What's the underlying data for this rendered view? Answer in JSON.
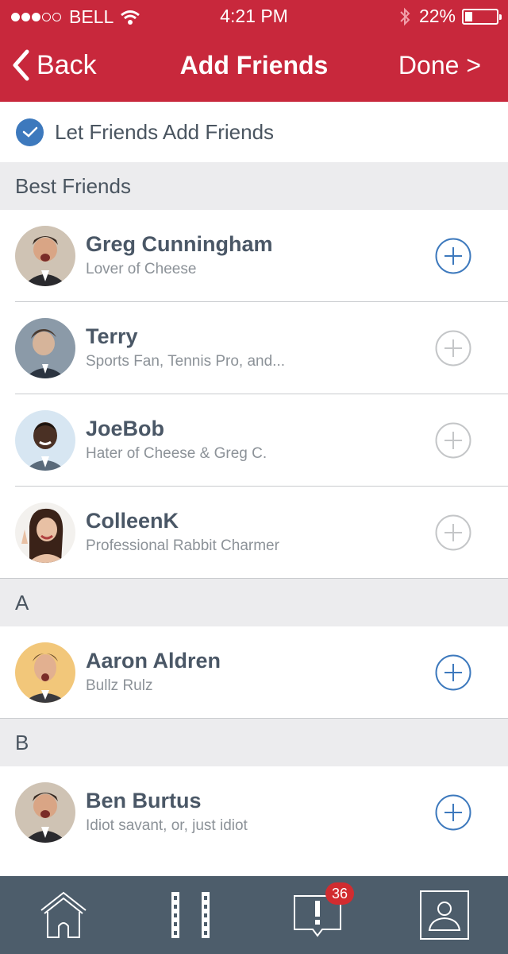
{
  "status_bar": {
    "carrier": "BELL",
    "time": "4:21 PM",
    "battery": "22%",
    "battery_level": 0.22,
    "signal_bars_filled": 3,
    "signal_bars_total": 5
  },
  "nav": {
    "back_label": "Back",
    "title": "Add Friends",
    "done_label": "Done >"
  },
  "toggle": {
    "label": "Let Friends Add Friends",
    "checked": true
  },
  "sections": [
    {
      "title": "Best Friends",
      "friends": [
        {
          "name": "Greg Cunningham",
          "subtitle": "Lover of Cheese",
          "add_active": true
        },
        {
          "name": "Terry",
          "subtitle": "Sports Fan, Tennis Pro, and...",
          "add_active": false
        },
        {
          "name": "JoeBob",
          "subtitle": "Hater of Cheese & Greg C.",
          "add_active": false
        },
        {
          "name": "ColleenK",
          "subtitle": "Professional Rabbit Charmer",
          "add_active": false
        }
      ]
    },
    {
      "title": "A",
      "friends": [
        {
          "name": "Aaron Aldren",
          "subtitle": "Bullz Rulz",
          "add_active": true
        }
      ]
    },
    {
      "title": "B",
      "friends": [
        {
          "name": "Ben Burtus",
          "subtitle": "Idiot savant, or, just idiot",
          "add_active": true
        }
      ]
    }
  ],
  "tabbar": {
    "tabs": [
      {
        "icon": "home-icon"
      },
      {
        "icon": "film-icon"
      },
      {
        "icon": "notifications-icon",
        "badge": "36"
      },
      {
        "icon": "profile-icon"
      }
    ]
  },
  "colors": {
    "brand_red": "#c8283c",
    "accent_blue": "#3d79bd",
    "tabbar": "#4d5d6b",
    "badge_red": "#d12c30"
  }
}
